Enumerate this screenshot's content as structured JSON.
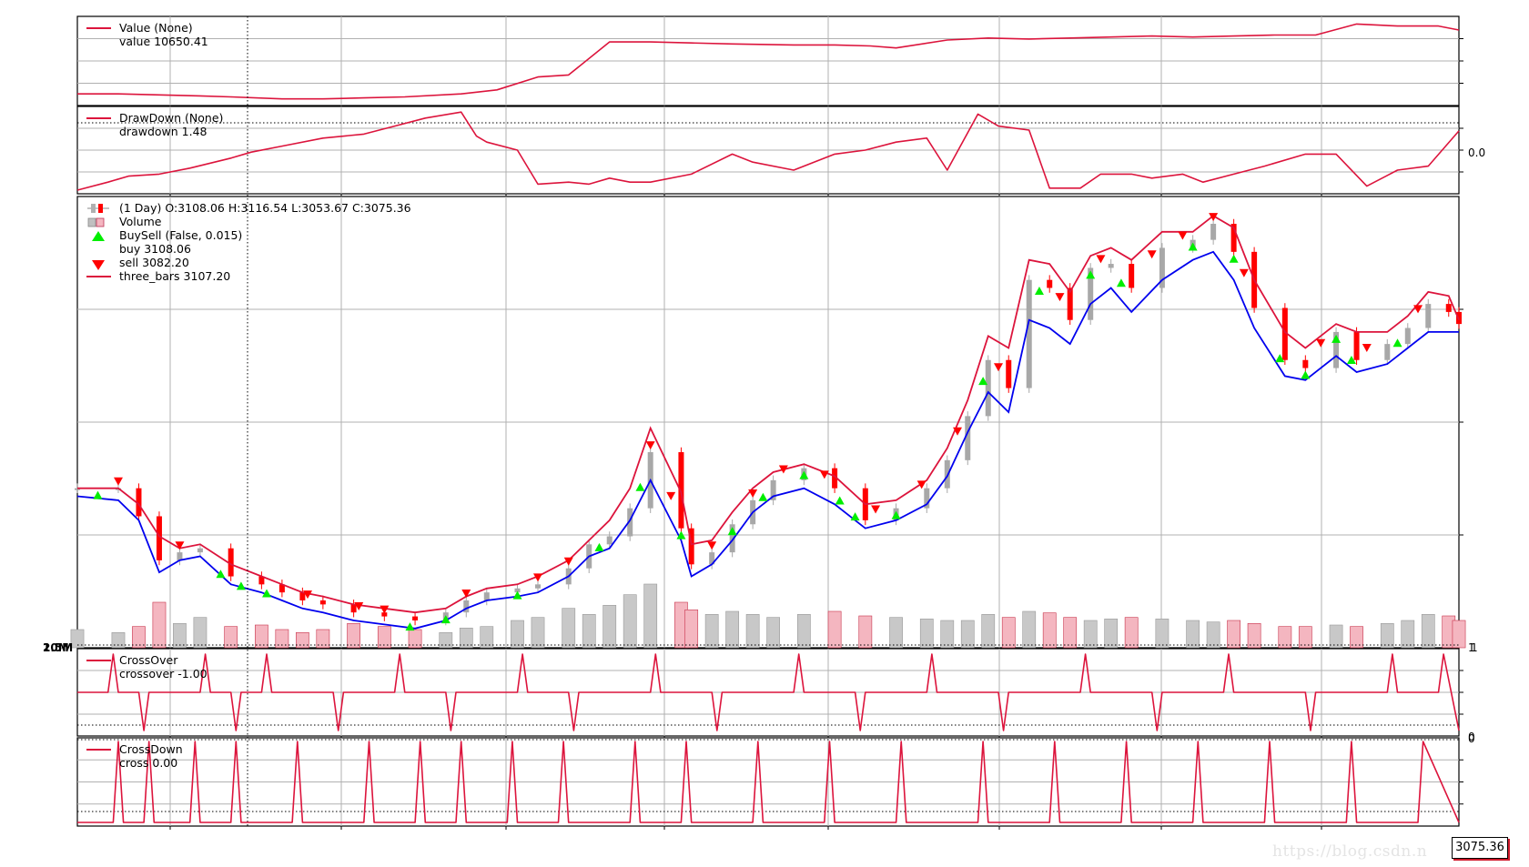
{
  "chart_data": [
    {
      "type": "line",
      "legend": [
        {
          "label": "Value (None)",
          "color": "#dc143c"
        },
        {
          "label": "value 10650.41",
          "color": "#dc143c"
        }
      ],
      "x": [
        0,
        8,
        16,
        24,
        30,
        40,
        48,
        56,
        64,
        75,
        82,
        90,
        96,
        104,
        112,
        120,
        128,
        140,
        148,
        155,
        160,
        170,
        178,
        186,
        194,
        202,
        210,
        218,
        226,
        234,
        242,
        250,
        258,
        266,
        270
      ],
      "values": [
        9960,
        9960,
        9950,
        9940,
        9930,
        9910,
        9910,
        9920,
        9930,
        9960,
        10000,
        10130,
        10150,
        10480,
        10480,
        10470,
        10460,
        10450,
        10450,
        10440,
        10420,
        10500,
        10520,
        10510,
        10520,
        10530,
        10540,
        10530,
        10540,
        10550,
        10550,
        10660,
        10640,
        10640,
        10600
      ],
      "legend_position": "top-left",
      "grid": true
    },
    {
      "type": "line",
      "legend": [
        {
          "label": "DrawDown (None)",
          "color": "#dc143c"
        },
        {
          "label": "drawdown 1.48",
          "color": "#dc143c"
        }
      ],
      "x": [
        0,
        6,
        10,
        16,
        22,
        30,
        34,
        40,
        48,
        56,
        62,
        68,
        75,
        78,
        80,
        86,
        90,
        96,
        100,
        104,
        108,
        112,
        120,
        128,
        132,
        140,
        148,
        154,
        160,
        166,
        170,
        176,
        180,
        186,
        190,
        196,
        200,
        206,
        210,
        216,
        220,
        226,
        232,
        240,
        246,
        252,
        258,
        264,
        270
      ],
      "values": [
        0,
        0.2,
        0.35,
        0.4,
        0.55,
        0.8,
        0.95,
        1.1,
        1.3,
        1.4,
        1.6,
        1.8,
        1.95,
        1.35,
        1.2,
        1.0,
        0.15,
        0.2,
        0.15,
        0.3,
        0.2,
        0.2,
        0.4,
        0.9,
        0.7,
        0.5,
        0.9,
        1.0,
        1.2,
        1.3,
        0.5,
        1.9,
        1.6,
        1.5,
        0.05,
        0.05,
        0.4,
        0.4,
        0.3,
        0.4,
        0.2,
        0.4,
        0.6,
        0.9,
        0.9,
        0.1,
        0.5,
        0.6,
        1.48
      ],
      "right_tick_label": "0.0",
      "legend_position": "top-left",
      "grid": true
    },
    {
      "type": "candlestick",
      "legend": [
        {
          "label": "(1 Day) O:3108.06 H:3116.54 L:3053.67 C:3075.36",
          "icon": "ohlc-icon"
        },
        {
          "label": "Volume",
          "icon": "volume-icon"
        },
        {
          "label": "BuySell (False, 0.015)",
          "icon": "triangle-up-icon",
          "color": "#00ee00"
        },
        {
          "label": "buy 3108.06",
          "icon": "",
          "color": "#00ee00"
        },
        {
          "label": "sell 3082.20",
          "icon": "triangle-down-icon",
          "color": "#ff0000"
        },
        {
          "label": "three_bars 3107.20",
          "icon": "line-icon",
          "color": "#dc143c"
        }
      ],
      "x": [
        0,
        8,
        12,
        16,
        20,
        24,
        30,
        36,
        40,
        44,
        48,
        54,
        60,
        66,
        72,
        76,
        80,
        86,
        90,
        96,
        100,
        104,
        108,
        112,
        118,
        120,
        124,
        128,
        132,
        136,
        142,
        148,
        154,
        160,
        166,
        170,
        174,
        178,
        182,
        186,
        190,
        194,
        198,
        202,
        206,
        212,
        218,
        222,
        226,
        230,
        236,
        240,
        246,
        250,
        256,
        260,
        264,
        268,
        270
      ],
      "close": [
        3300,
        3300,
        3230,
        3120,
        3140,
        3150,
        3080,
        3060,
        3040,
        3020,
        3010,
        2990,
        2980,
        2970,
        2990,
        3020,
        3040,
        3050,
        3060,
        3100,
        3160,
        3180,
        3250,
        3390,
        3200,
        3110,
        3140,
        3210,
        3270,
        3320,
        3350,
        3300,
        3220,
        3250,
        3300,
        3370,
        3480,
        3620,
        3550,
        3820,
        3800,
        3720,
        3850,
        3860,
        3800,
        3900,
        3920,
        3960,
        3890,
        3750,
        3620,
        3600,
        3690,
        3620,
        3660,
        3700,
        3760,
        3740,
        3710
      ],
      "three_bars_upper": [
        3300,
        3300,
        3260,
        3180,
        3150,
        3160,
        3110,
        3080,
        3060,
        3040,
        3030,
        3010,
        3000,
        2990,
        3000,
        3030,
        3050,
        3060,
        3080,
        3120,
        3170,
        3220,
        3300,
        3450,
        3290,
        3160,
        3170,
        3240,
        3300,
        3340,
        3360,
        3330,
        3260,
        3270,
        3320,
        3400,
        3520,
        3680,
        3650,
        3870,
        3860,
        3790,
        3880,
        3900,
        3870,
        3940,
        3940,
        3980,
        3950,
        3820,
        3690,
        3650,
        3710,
        3690,
        3690,
        3730,
        3790,
        3780,
        3720
      ],
      "three_bars_lower": [
        3280,
        3270,
        3220,
        3090,
        3120,
        3130,
        3060,
        3040,
        3020,
        3000,
        2990,
        2970,
        2960,
        2950,
        2970,
        3000,
        3020,
        3030,
        3040,
        3080,
        3130,
        3150,
        3220,
        3320,
        3170,
        3080,
        3110,
        3170,
        3240,
        3280,
        3300,
        3260,
        3200,
        3220,
        3260,
        3330,
        3440,
        3540,
        3490,
        3720,
        3700,
        3660,
        3760,
        3800,
        3740,
        3820,
        3870,
        3890,
        3820,
        3700,
        3580,
        3570,
        3630,
        3590,
        3610,
        3650,
        3690,
        3690,
        3690
      ],
      "buy_x": [
        4,
        28,
        32,
        37,
        65,
        72,
        86,
        102,
        110,
        118,
        128,
        134,
        142,
        149,
        152,
        160,
        177,
        188,
        198,
        204,
        218,
        226,
        235,
        240,
        246,
        249,
        258
      ],
      "sell_x": [
        8,
        20,
        45,
        55,
        60,
        76,
        90,
        96,
        112,
        116,
        124,
        132,
        138,
        146,
        156,
        165,
        172,
        180,
        192,
        200,
        210,
        216,
        222,
        228,
        243,
        252,
        262
      ],
      "volume": [
        12,
        10,
        14,
        30,
        16,
        20,
        14,
        15,
        12,
        10,
        12,
        16,
        14,
        12,
        10,
        13,
        14,
        18,
        20,
        26,
        22,
        28,
        35,
        42,
        30,
        25,
        22,
        24,
        22,
        20,
        22,
        24,
        21,
        20,
        19,
        18,
        18,
        22,
        20,
        24,
        23,
        20,
        18,
        19,
        20,
        19,
        18,
        17,
        18,
        16,
        14,
        14,
        15,
        14,
        16,
        18,
        22,
        21,
        18
      ],
      "ylim": [
        2920,
        4010
      ],
      "right_tick_labels": [
        "1",
        "1"
      ],
      "left_tick_labels": [
        "2.5M",
        "10M"
      ],
      "last_price": "3075.36",
      "legend_position": "top-left",
      "grid": true
    },
    {
      "type": "line",
      "legend": [
        {
          "label": "CrossOver",
          "color": "#dc143c"
        },
        {
          "label": "crossover -1.00",
          "color": "#dc143c"
        }
      ],
      "x": [
        0,
        6,
        7,
        8,
        12,
        13,
        14,
        24,
        25,
        26,
        30,
        31,
        32,
        36,
        37,
        38,
        50,
        51,
        52,
        62,
        63,
        64,
        72,
        73,
        74,
        86,
        87,
        88,
        96,
        97,
        98,
        112,
        113,
        114,
        124,
        125,
        126,
        140,
        141,
        142,
        152,
        153,
        154,
        166,
        167,
        168,
        180,
        181,
        182,
        196,
        197,
        198,
        210,
        211,
        212,
        224,
        225,
        226,
        240,
        241,
        242,
        256,
        257,
        258,
        266,
        267,
        270
      ],
      "values": [
        0,
        0,
        1,
        0,
        0,
        -1,
        0,
        0,
        1,
        0,
        0,
        -1,
        0,
        0,
        1,
        0,
        0,
        -1,
        0,
        0,
        1,
        0,
        0,
        -1,
        0,
        0,
        1,
        0,
        0,
        -1,
        0,
        0,
        1,
        0,
        0,
        -1,
        0,
        0,
        1,
        0,
        0,
        -1,
        0,
        0,
        1,
        0,
        0,
        -1,
        0,
        0,
        1,
        0,
        0,
        -1,
        0,
        0,
        1,
        0,
        0,
        -1,
        0,
        0,
        1,
        0,
        0,
        1,
        -1
      ],
      "right_tick_labels": [
        "1",
        "1",
        "0"
      ],
      "ylim": [
        -1,
        1
      ],
      "legend_position": "top-left",
      "grid": true
    },
    {
      "type": "line",
      "legend": [
        {
          "label": "CrossDown",
          "color": "#dc143c"
        },
        {
          "label": "cross 0.00",
          "color": "#dc143c"
        }
      ],
      "x": [
        0,
        7,
        8,
        9,
        13,
        14,
        15,
        22,
        23,
        24,
        30,
        31,
        32,
        42,
        43,
        44,
        56,
        57,
        58,
        66,
        67,
        68,
        74,
        75,
        76,
        84,
        85,
        86,
        94,
        95,
        96,
        108,
        109,
        110,
        118,
        119,
        120,
        132,
        133,
        134,
        146,
        147,
        148,
        160,
        161,
        162,
        176,
        177,
        178,
        190,
        191,
        192,
        204,
        205,
        206,
        218,
        219,
        220,
        232,
        233,
        234,
        248,
        249,
        250,
        262,
        263,
        270
      ],
      "values": [
        0,
        0,
        1,
        0,
        0,
        1,
        0,
        0,
        1,
        0,
        0,
        1,
        0,
        0,
        1,
        0,
        0,
        1,
        0,
        0,
        1,
        0,
        0,
        1,
        0,
        0,
        1,
        0,
        0,
        1,
        0,
        0,
        1,
        0,
        0,
        1,
        0,
        0,
        1,
        0,
        0,
        1,
        0,
        0,
        1,
        0,
        0,
        1,
        0,
        0,
        1,
        0,
        0,
        1,
        0,
        0,
        1,
        0,
        0,
        1,
        0,
        0,
        1,
        0,
        0,
        1,
        0
      ],
      "right_tick_labels": [
        "0"
      ],
      "ylim": [
        0,
        1
      ],
      "legend_position": "top-left",
      "grid": true
    }
  ],
  "watermark": "https://blog.csdn.n",
  "price_tag": "3075.36"
}
